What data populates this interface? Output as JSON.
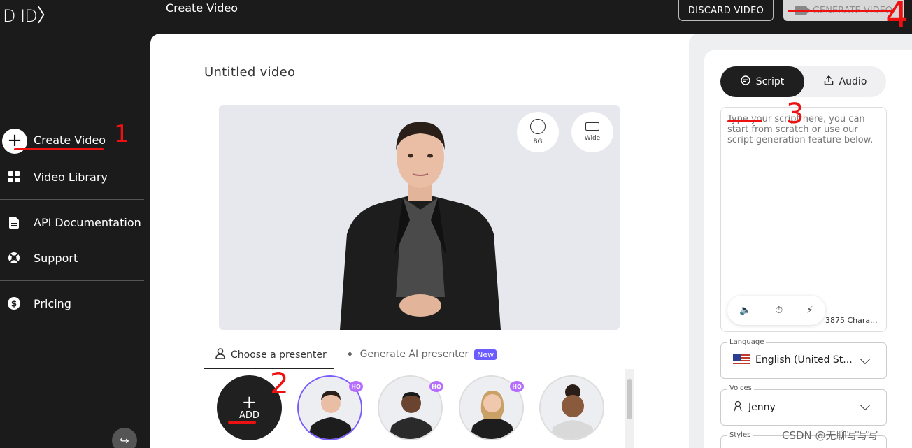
{
  "topbar": {
    "logo": "D-ID",
    "title": "Create Video",
    "discard_label": "DISCARD VIDEO",
    "generate_label": "GENERATE VIDEO"
  },
  "sidebar": {
    "items": [
      {
        "label": "Create Video",
        "icon": "plus-icon"
      },
      {
        "label": "Video Library",
        "icon": "grid-icon"
      },
      {
        "label": "API Documentation",
        "icon": "document-icon"
      },
      {
        "label": "Support",
        "icon": "lifebuoy-icon"
      },
      {
        "label": "Pricing",
        "icon": "dollar-icon"
      }
    ]
  },
  "editor": {
    "video_title": "Untitled video",
    "bg_label": "BG",
    "wide_label": "Wide",
    "tabs": {
      "choose": "Choose a presenter",
      "generate": "Generate AI presenter",
      "new_badge": "New"
    },
    "add_label": "ADD",
    "hq_badge": "HQ"
  },
  "script_panel": {
    "script_tab": "Script",
    "audio_tab": "Audio",
    "placeholder": "Type your script here, you can start from scratch or use our script-generation feature below.",
    "char_count": "3875 Chara...",
    "language_label": "Language",
    "language_value": "English (United St...",
    "voices_label": "Voices",
    "voice_value": "Jenny",
    "styles_label": "Styles"
  },
  "annotations": {
    "n1": "1",
    "n2": "2",
    "n3": "3",
    "n4": "4"
  },
  "watermarks": {
    "csdn": "CSDN @无聊写写写"
  },
  "colors": {
    "sidebar_bg": "#1b1b1b",
    "accent_purple": "#7b5cff",
    "annotation_red": "#e11111"
  }
}
